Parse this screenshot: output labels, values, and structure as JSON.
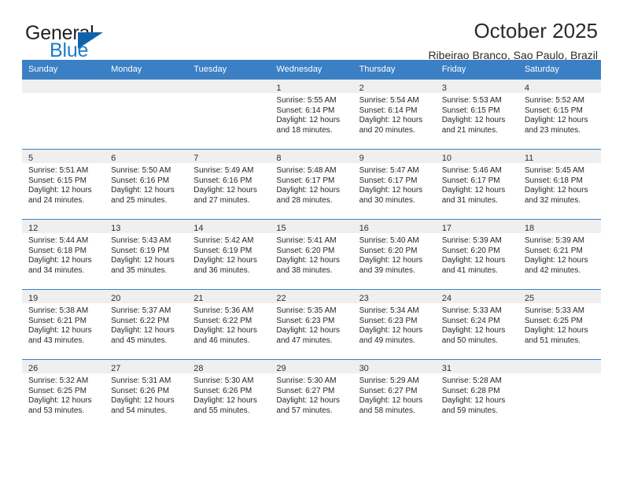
{
  "brand": {
    "name_part1": "General",
    "name_part2": "Blue",
    "triangle_color": "#1063a8",
    "blue_color": "#1b7ec4"
  },
  "header": {
    "title": "October 2025",
    "subtitle": "Ribeirao Branco, Sao Paulo, Brazil"
  },
  "theme": {
    "header_bg": "#3b7fc4",
    "daynum_bg": "#efefef",
    "cell_bg": "#ffffff",
    "text": "#262626"
  },
  "weekdays": [
    "Sunday",
    "Monday",
    "Tuesday",
    "Wednesday",
    "Thursday",
    "Friday",
    "Saturday"
  ],
  "weeks": [
    [
      {
        "day": "",
        "empty": true
      },
      {
        "day": "",
        "empty": true
      },
      {
        "day": "",
        "empty": true
      },
      {
        "day": "1",
        "sunrise": "Sunrise: 5:55 AM",
        "sunset": "Sunset: 6:14 PM",
        "daylight_1": "Daylight: 12 hours",
        "daylight_2": "and 18 minutes."
      },
      {
        "day": "2",
        "sunrise": "Sunrise: 5:54 AM",
        "sunset": "Sunset: 6:14 PM",
        "daylight_1": "Daylight: 12 hours",
        "daylight_2": "and 20 minutes."
      },
      {
        "day": "3",
        "sunrise": "Sunrise: 5:53 AM",
        "sunset": "Sunset: 6:15 PM",
        "daylight_1": "Daylight: 12 hours",
        "daylight_2": "and 21 minutes."
      },
      {
        "day": "4",
        "sunrise": "Sunrise: 5:52 AM",
        "sunset": "Sunset: 6:15 PM",
        "daylight_1": "Daylight: 12 hours",
        "daylight_2": "and 23 minutes."
      }
    ],
    [
      {
        "day": "5",
        "sunrise": "Sunrise: 5:51 AM",
        "sunset": "Sunset: 6:15 PM",
        "daylight_1": "Daylight: 12 hours",
        "daylight_2": "and 24 minutes."
      },
      {
        "day": "6",
        "sunrise": "Sunrise: 5:50 AM",
        "sunset": "Sunset: 6:16 PM",
        "daylight_1": "Daylight: 12 hours",
        "daylight_2": "and 25 minutes."
      },
      {
        "day": "7",
        "sunrise": "Sunrise: 5:49 AM",
        "sunset": "Sunset: 6:16 PM",
        "daylight_1": "Daylight: 12 hours",
        "daylight_2": "and 27 minutes."
      },
      {
        "day": "8",
        "sunrise": "Sunrise: 5:48 AM",
        "sunset": "Sunset: 6:17 PM",
        "daylight_1": "Daylight: 12 hours",
        "daylight_2": "and 28 minutes."
      },
      {
        "day": "9",
        "sunrise": "Sunrise: 5:47 AM",
        "sunset": "Sunset: 6:17 PM",
        "daylight_1": "Daylight: 12 hours",
        "daylight_2": "and 30 minutes."
      },
      {
        "day": "10",
        "sunrise": "Sunrise: 5:46 AM",
        "sunset": "Sunset: 6:17 PM",
        "daylight_1": "Daylight: 12 hours",
        "daylight_2": "and 31 minutes."
      },
      {
        "day": "11",
        "sunrise": "Sunrise: 5:45 AM",
        "sunset": "Sunset: 6:18 PM",
        "daylight_1": "Daylight: 12 hours",
        "daylight_2": "and 32 minutes."
      }
    ],
    [
      {
        "day": "12",
        "sunrise": "Sunrise: 5:44 AM",
        "sunset": "Sunset: 6:18 PM",
        "daylight_1": "Daylight: 12 hours",
        "daylight_2": "and 34 minutes."
      },
      {
        "day": "13",
        "sunrise": "Sunrise: 5:43 AM",
        "sunset": "Sunset: 6:19 PM",
        "daylight_1": "Daylight: 12 hours",
        "daylight_2": "and 35 minutes."
      },
      {
        "day": "14",
        "sunrise": "Sunrise: 5:42 AM",
        "sunset": "Sunset: 6:19 PM",
        "daylight_1": "Daylight: 12 hours",
        "daylight_2": "and 36 minutes."
      },
      {
        "day": "15",
        "sunrise": "Sunrise: 5:41 AM",
        "sunset": "Sunset: 6:20 PM",
        "daylight_1": "Daylight: 12 hours",
        "daylight_2": "and 38 minutes."
      },
      {
        "day": "16",
        "sunrise": "Sunrise: 5:40 AM",
        "sunset": "Sunset: 6:20 PM",
        "daylight_1": "Daylight: 12 hours",
        "daylight_2": "and 39 minutes."
      },
      {
        "day": "17",
        "sunrise": "Sunrise: 5:39 AM",
        "sunset": "Sunset: 6:20 PM",
        "daylight_1": "Daylight: 12 hours",
        "daylight_2": "and 41 minutes."
      },
      {
        "day": "18",
        "sunrise": "Sunrise: 5:39 AM",
        "sunset": "Sunset: 6:21 PM",
        "daylight_1": "Daylight: 12 hours",
        "daylight_2": "and 42 minutes."
      }
    ],
    [
      {
        "day": "19",
        "sunrise": "Sunrise: 5:38 AM",
        "sunset": "Sunset: 6:21 PM",
        "daylight_1": "Daylight: 12 hours",
        "daylight_2": "and 43 minutes."
      },
      {
        "day": "20",
        "sunrise": "Sunrise: 5:37 AM",
        "sunset": "Sunset: 6:22 PM",
        "daylight_1": "Daylight: 12 hours",
        "daylight_2": "and 45 minutes."
      },
      {
        "day": "21",
        "sunrise": "Sunrise: 5:36 AM",
        "sunset": "Sunset: 6:22 PM",
        "daylight_1": "Daylight: 12 hours",
        "daylight_2": "and 46 minutes."
      },
      {
        "day": "22",
        "sunrise": "Sunrise: 5:35 AM",
        "sunset": "Sunset: 6:23 PM",
        "daylight_1": "Daylight: 12 hours",
        "daylight_2": "and 47 minutes."
      },
      {
        "day": "23",
        "sunrise": "Sunrise: 5:34 AM",
        "sunset": "Sunset: 6:23 PM",
        "daylight_1": "Daylight: 12 hours",
        "daylight_2": "and 49 minutes."
      },
      {
        "day": "24",
        "sunrise": "Sunrise: 5:33 AM",
        "sunset": "Sunset: 6:24 PM",
        "daylight_1": "Daylight: 12 hours",
        "daylight_2": "and 50 minutes."
      },
      {
        "day": "25",
        "sunrise": "Sunrise: 5:33 AM",
        "sunset": "Sunset: 6:25 PM",
        "daylight_1": "Daylight: 12 hours",
        "daylight_2": "and 51 minutes."
      }
    ],
    [
      {
        "day": "26",
        "sunrise": "Sunrise: 5:32 AM",
        "sunset": "Sunset: 6:25 PM",
        "daylight_1": "Daylight: 12 hours",
        "daylight_2": "and 53 minutes."
      },
      {
        "day": "27",
        "sunrise": "Sunrise: 5:31 AM",
        "sunset": "Sunset: 6:26 PM",
        "daylight_1": "Daylight: 12 hours",
        "daylight_2": "and 54 minutes."
      },
      {
        "day": "28",
        "sunrise": "Sunrise: 5:30 AM",
        "sunset": "Sunset: 6:26 PM",
        "daylight_1": "Daylight: 12 hours",
        "daylight_2": "and 55 minutes."
      },
      {
        "day": "29",
        "sunrise": "Sunrise: 5:30 AM",
        "sunset": "Sunset: 6:27 PM",
        "daylight_1": "Daylight: 12 hours",
        "daylight_2": "and 57 minutes."
      },
      {
        "day": "30",
        "sunrise": "Sunrise: 5:29 AM",
        "sunset": "Sunset: 6:27 PM",
        "daylight_1": "Daylight: 12 hours",
        "daylight_2": "and 58 minutes."
      },
      {
        "day": "31",
        "sunrise": "Sunrise: 5:28 AM",
        "sunset": "Sunset: 6:28 PM",
        "daylight_1": "Daylight: 12 hours",
        "daylight_2": "and 59 minutes."
      },
      {
        "day": "",
        "empty": true
      }
    ]
  ]
}
